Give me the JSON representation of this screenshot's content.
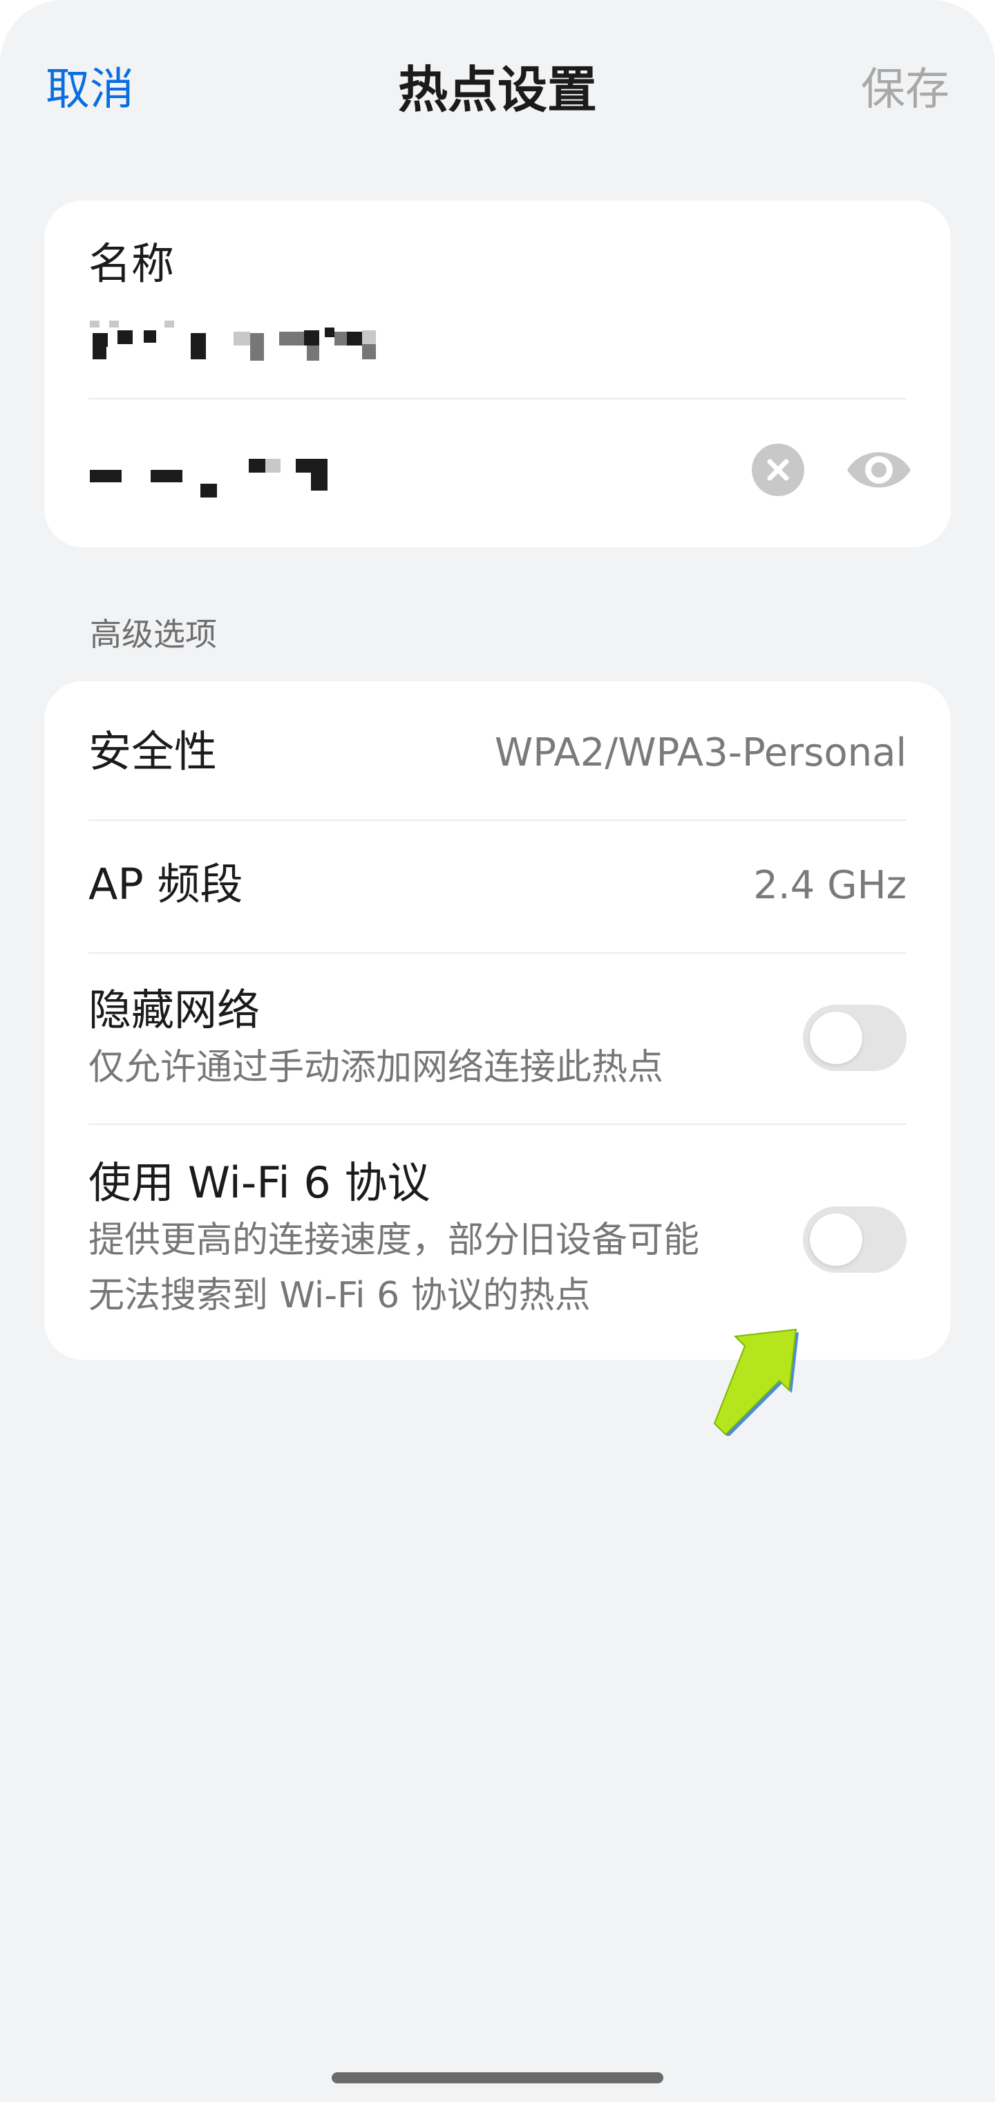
{
  "header": {
    "cancel_label": "取消",
    "title": "热点设置",
    "save_label": "保存"
  },
  "name_card": {
    "name_label": "名称",
    "icons": {
      "clear": "clear-circle-x-icon",
      "show_password": "eye-icon"
    }
  },
  "advanced": {
    "section_label": "高级选项",
    "security": {
      "label": "安全性",
      "value": "WPA2/WPA3-Personal"
    },
    "ap_band": {
      "label": "AP 频段",
      "value": "2.4 GHz"
    },
    "hide_network": {
      "label": "隐藏网络",
      "desc": "仅允许通过手动添加网络连接此热点",
      "enabled": false
    },
    "wifi6": {
      "label": "使用 Wi-Fi 6 协议",
      "desc_line1": "提供更高的连接速度，部分旧设备可能",
      "desc_line2": "无法搜索到 Wi-Fi 6 协议的热点",
      "enabled": false
    }
  },
  "colors": {
    "accent": "#0a6ee0",
    "background": "#f2f3f5",
    "card": "#ffffff",
    "annotation_arrow": "#b5e61d"
  }
}
